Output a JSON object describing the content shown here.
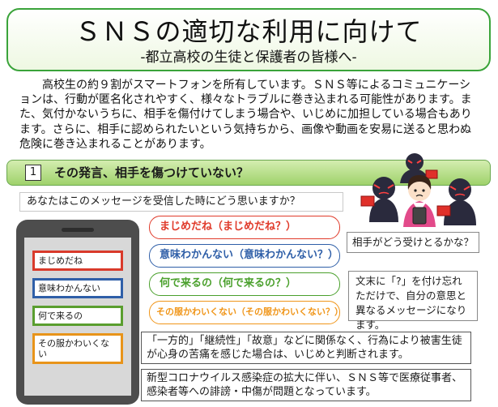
{
  "header": {
    "title": "ＳＮＳの適切な利用に向けて",
    "subtitle": "-都立高校の生徒と保護者の皆様へ-"
  },
  "intro": "高校生の約９割がスマートフォンを所有しています。ＳＮＳ等によるコミュニケーションは、行動が匿名化されやすく、様々なトラブルに巻き込まれる可能性があります。また、気付かないうちに、相手を傷付けてしまう場合や、いじめに加担している場合もあります。さらに、相手に認められたいという気持ちから、画像や動画を安易に送ると思わぬ危険に巻き込まれることがあります。",
  "section": {
    "number": "1",
    "title": "その発言、相手を傷つけていない？"
  },
  "question": "あなたはこのメッセージを受信した時にどう思いますか？",
  "phone_messages": [
    {
      "text": "まじめだね",
      "color": "#d93a2b"
    },
    {
      "text": "意味わかんない",
      "color": "#2f5fa8"
    },
    {
      "text": "何で来るの",
      "color": "#5a9e2f"
    },
    {
      "text": "その服かわいくない",
      "color": "#e8941a"
    }
  ],
  "bubbles": [
    {
      "text": "まじめだね（まじめだね？）",
      "color": "#e03a2a"
    },
    {
      "text": "意味わかんない（意味わかんない？）",
      "color": "#2f5fa8"
    },
    {
      "text": "何で来るの（何で来るの？）",
      "color": "#4aa02c"
    },
    {
      "text": "その服かわいくない（その服かわいくない？）",
      "color": "#f0961a"
    }
  ],
  "side_question": "相手がどう受けとるかな？",
  "side_note": "文末に「?」を付け忘れただけで、自分の意思と異なるメッセージになります。",
  "info_boxes": [
    "「一方的」「継続性」「故意」などに関係なく、行為により被害生徒が心身の苦痛を感じた場合は、いじめと判断されます。",
    "新型コロナウイルス感染症の拡大に伴い、ＳＮＳ等で医療従事者、感染者等への誹謗・中傷が問題となっています。"
  ]
}
